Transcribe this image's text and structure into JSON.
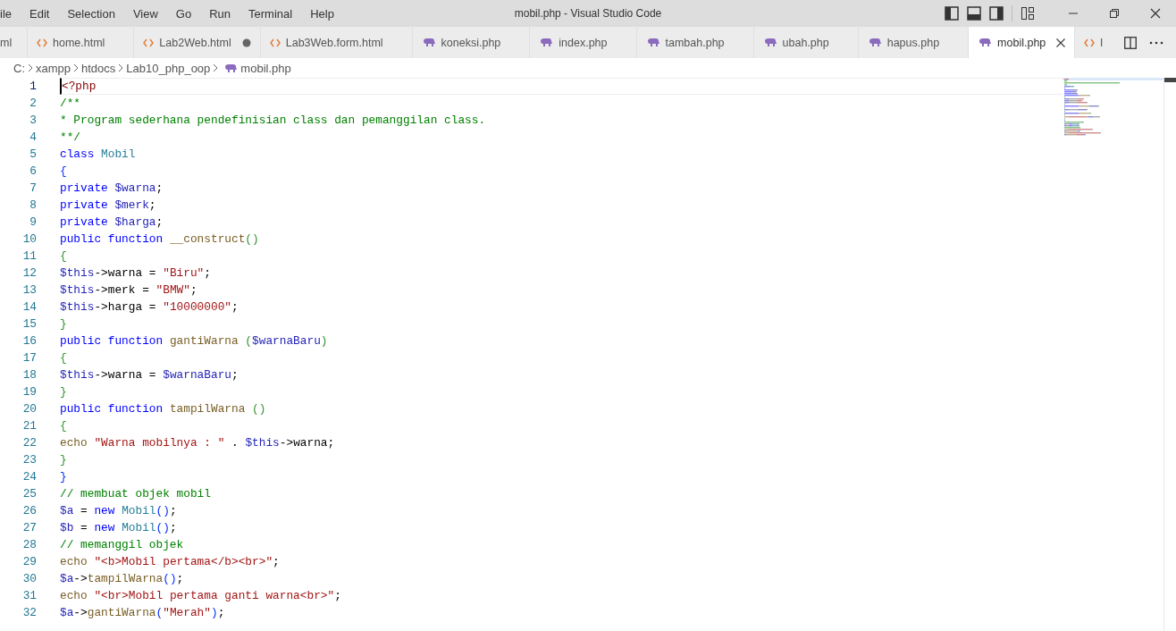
{
  "menu": [
    "ile",
    "Edit",
    "Selection",
    "View",
    "Go",
    "Run",
    "Terminal",
    "Help"
  ],
  "window": {
    "title": "mobil.php - Visual Studio Code"
  },
  "tabs": [
    {
      "label": "ml",
      "kind": "none",
      "selected": false
    },
    {
      "label": "home.html",
      "kind": "html",
      "selected": false,
      "modified": false
    },
    {
      "label": "Lab2Web.html",
      "kind": "html",
      "selected": false,
      "modified": true
    },
    {
      "label": "Lab3Web.form.html",
      "kind": "html",
      "selected": false,
      "modified": false
    },
    {
      "label": "koneksi.php",
      "kind": "php",
      "selected": false,
      "modified": false
    },
    {
      "label": "index.php",
      "kind": "php",
      "selected": false,
      "modified": false
    },
    {
      "label": "tambah.php",
      "kind": "php",
      "selected": false,
      "modified": false
    },
    {
      "label": "ubah.php",
      "kind": "php",
      "selected": false,
      "modified": false
    },
    {
      "label": "hapus.php",
      "kind": "php",
      "selected": false,
      "modified": false
    },
    {
      "label": "mobil.php",
      "kind": "php",
      "selected": true,
      "modified": false
    },
    {
      "label": "l",
      "kind": "html",
      "selected": false
    }
  ],
  "breadcrumb": [
    {
      "label": "C:",
      "kind": "folder"
    },
    {
      "label": "xampp",
      "kind": "folder"
    },
    {
      "label": "htdocs",
      "kind": "folder"
    },
    {
      "label": "Lab10_php_oop",
      "kind": "folder"
    },
    {
      "label": "mobil.php",
      "kind": "php"
    }
  ],
  "lines": [
    {
      "number": "1",
      "current": true,
      "tokens": [
        {
          "kind": "tag",
          "text": "<?php"
        }
      ]
    },
    {
      "number": "2",
      "current": false,
      "tokens": [
        {
          "kind": "comment",
          "text": "/**"
        }
      ]
    },
    {
      "number": "3",
      "current": false,
      "tokens": [
        {
          "kind": "comment",
          "text": "* Program sederhana pendefinisian class dan pemanggilan class."
        }
      ]
    },
    {
      "number": "4",
      "current": false,
      "tokens": [
        {
          "kind": "comment",
          "text": "**/"
        }
      ]
    },
    {
      "number": "5",
      "current": false,
      "tokens": [
        {
          "kind": "keyword",
          "text": "class "
        },
        {
          "kind": "type",
          "text": "Mobil"
        }
      ]
    },
    {
      "number": "6",
      "current": false,
      "tokens": [
        {
          "kind": "brace1",
          "text": "{"
        }
      ]
    },
    {
      "number": "7",
      "current": false,
      "tokens": [
        {
          "kind": "keyword",
          "text": "private "
        },
        {
          "kind": "var",
          "text": "$warna"
        },
        {
          "kind": "plain",
          "text": ";"
        }
      ]
    },
    {
      "number": "8",
      "current": false,
      "tokens": [
        {
          "kind": "keyword",
          "text": "private "
        },
        {
          "kind": "var",
          "text": "$merk"
        },
        {
          "kind": "plain",
          "text": ";"
        }
      ]
    },
    {
      "number": "9",
      "current": false,
      "tokens": [
        {
          "kind": "keyword",
          "text": "private "
        },
        {
          "kind": "var",
          "text": "$harga"
        },
        {
          "kind": "plain",
          "text": ";"
        }
      ]
    },
    {
      "number": "10",
      "current": false,
      "tokens": [
        {
          "kind": "keyword",
          "text": "public function "
        },
        {
          "kind": "func",
          "text": "__construct"
        },
        {
          "kind": "brace2",
          "text": "()"
        }
      ]
    },
    {
      "number": "11",
      "current": false,
      "tokens": [
        {
          "kind": "brace2",
          "text": "{"
        }
      ]
    },
    {
      "number": "12",
      "current": false,
      "tokens": [
        {
          "kind": "var",
          "text": "$this"
        },
        {
          "kind": "plain",
          "text": "->warna = "
        },
        {
          "kind": "string",
          "text": "\"Biru\""
        },
        {
          "kind": "plain",
          "text": ";"
        }
      ]
    },
    {
      "number": "13",
      "current": false,
      "tokens": [
        {
          "kind": "var",
          "text": "$this"
        },
        {
          "kind": "plain",
          "text": "->merk = "
        },
        {
          "kind": "string",
          "text": "\"BMW\""
        },
        {
          "kind": "plain",
          "text": ";"
        }
      ]
    },
    {
      "number": "14",
      "current": false,
      "tokens": [
        {
          "kind": "var",
          "text": "$this"
        },
        {
          "kind": "plain",
          "text": "->harga = "
        },
        {
          "kind": "string",
          "text": "\"10000000\""
        },
        {
          "kind": "plain",
          "text": ";"
        }
      ]
    },
    {
      "number": "15",
      "current": false,
      "tokens": [
        {
          "kind": "brace2",
          "text": "}"
        }
      ]
    },
    {
      "number": "16",
      "current": false,
      "tokens": [
        {
          "kind": "keyword",
          "text": "public function "
        },
        {
          "kind": "func",
          "text": "gantiWarna "
        },
        {
          "kind": "brace2",
          "text": "("
        },
        {
          "kind": "var",
          "text": "$warnaBaru"
        },
        {
          "kind": "brace2",
          "text": ")"
        }
      ]
    },
    {
      "number": "17",
      "current": false,
      "tokens": [
        {
          "kind": "brace2",
          "text": "{"
        }
      ]
    },
    {
      "number": "18",
      "current": false,
      "tokens": [
        {
          "kind": "var",
          "text": "$this"
        },
        {
          "kind": "plain",
          "text": "->warna = "
        },
        {
          "kind": "var",
          "text": "$warnaBaru"
        },
        {
          "kind": "plain",
          "text": ";"
        }
      ]
    },
    {
      "number": "19",
      "current": false,
      "tokens": [
        {
          "kind": "brace2",
          "text": "}"
        }
      ]
    },
    {
      "number": "20",
      "current": false,
      "tokens": [
        {
          "kind": "keyword",
          "text": "public function "
        },
        {
          "kind": "func",
          "text": "tampilWarna "
        },
        {
          "kind": "brace2",
          "text": "()"
        }
      ]
    },
    {
      "number": "21",
      "current": false,
      "tokens": [
        {
          "kind": "brace2",
          "text": "{"
        }
      ]
    },
    {
      "number": "22",
      "current": false,
      "tokens": [
        {
          "kind": "func",
          "text": "echo "
        },
        {
          "kind": "string",
          "text": "\"Warna mobilnya : \""
        },
        {
          "kind": "plain",
          "text": " . "
        },
        {
          "kind": "var",
          "text": "$this"
        },
        {
          "kind": "plain",
          "text": "->warna;"
        }
      ]
    },
    {
      "number": "23",
      "current": false,
      "tokens": [
        {
          "kind": "brace2",
          "text": "}"
        }
      ]
    },
    {
      "number": "24",
      "current": false,
      "tokens": [
        {
          "kind": "brace1",
          "text": "}"
        }
      ]
    },
    {
      "number": "25",
      "current": false,
      "tokens": [
        {
          "kind": "comment",
          "text": "// membuat objek mobil"
        }
      ]
    },
    {
      "number": "26",
      "current": false,
      "tokens": [
        {
          "kind": "var",
          "text": "$a"
        },
        {
          "kind": "plain",
          "text": " = "
        },
        {
          "kind": "keyword",
          "text": "new "
        },
        {
          "kind": "type",
          "text": "Mobil"
        },
        {
          "kind": "brace1",
          "text": "()"
        },
        {
          "kind": "plain",
          "text": ";"
        }
      ]
    },
    {
      "number": "27",
      "current": false,
      "tokens": [
        {
          "kind": "var",
          "text": "$b"
        },
        {
          "kind": "plain",
          "text": " = "
        },
        {
          "kind": "keyword",
          "text": "new "
        },
        {
          "kind": "type",
          "text": "Mobil"
        },
        {
          "kind": "brace1",
          "text": "()"
        },
        {
          "kind": "plain",
          "text": ";"
        }
      ]
    },
    {
      "number": "28",
      "current": false,
      "tokens": [
        {
          "kind": "comment",
          "text": "// memanggil objek"
        }
      ]
    },
    {
      "number": "29",
      "current": false,
      "tokens": [
        {
          "kind": "func",
          "text": "echo "
        },
        {
          "kind": "string",
          "text": "\"<b>Mobil pertama</b><br>\""
        },
        {
          "kind": "plain",
          "text": ";"
        }
      ]
    },
    {
      "number": "30",
      "current": false,
      "tokens": [
        {
          "kind": "var",
          "text": "$a"
        },
        {
          "kind": "plain",
          "text": "->"
        },
        {
          "kind": "func",
          "text": "tampilWarna"
        },
        {
          "kind": "brace1",
          "text": "()"
        },
        {
          "kind": "plain",
          "text": ";"
        }
      ]
    },
    {
      "number": "31",
      "current": false,
      "tokens": [
        {
          "kind": "func",
          "text": "echo "
        },
        {
          "kind": "string",
          "text": "\"<br>Mobil pertama ganti warna<br>\""
        },
        {
          "kind": "plain",
          "text": ";"
        }
      ]
    },
    {
      "number": "32",
      "current": false,
      "tokens": [
        {
          "kind": "var",
          "text": "$a"
        },
        {
          "kind": "plain",
          "text": "->"
        },
        {
          "kind": "func",
          "text": "gantiWarna"
        },
        {
          "kind": "brace1",
          "text": "("
        },
        {
          "kind": "string",
          "text": "\"Merah\""
        },
        {
          "kind": "brace1",
          "text": ")"
        },
        {
          "kind": "plain",
          "text": ";"
        }
      ]
    }
  ]
}
